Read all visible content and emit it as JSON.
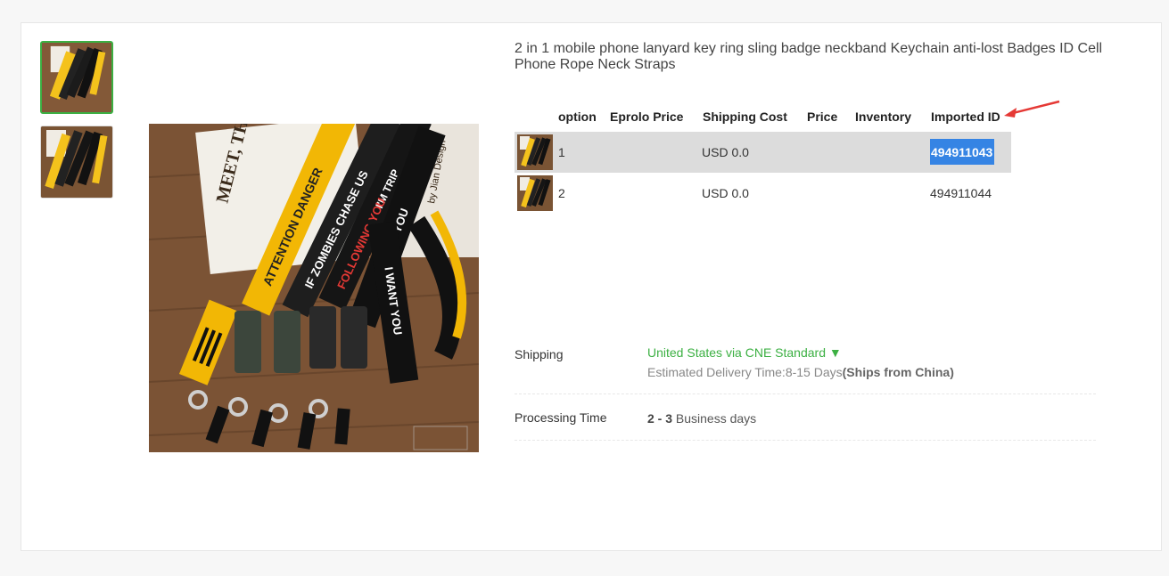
{
  "product": {
    "title": "2 in 1 mobile phone lanyard key ring sling badge neckband Keychain anti-lost Badges ID Cell Phone Rope Neck Straps"
  },
  "gallery": {
    "photo_text": [
      "MEET, THEN; MISS, OR LOVE.",
      "by Jian Design",
      "ATTENTION DANGER",
      "IF ZOMBIES CHASE US",
      "I'M TRIP",
      "FOLLOWING YOU",
      "I WANT YOU",
      "I WANT YOU"
    ]
  },
  "variants": {
    "headers": {
      "option": "option",
      "eprolo_price": "Eprolo Price",
      "shipping_cost": "Shipping Cost",
      "price": "Price",
      "inventory": "Inventory",
      "imported_id": "Imported ID"
    },
    "rows": [
      {
        "option": "1",
        "eprolo_price": "",
        "shipping_cost": "USD 0.0",
        "price": "",
        "inventory": "",
        "imported_id": "494911043"
      },
      {
        "option": "2",
        "eprolo_price": "",
        "shipping_cost": "USD 0.0",
        "price": "",
        "inventory": "",
        "imported_id": "494911044"
      }
    ]
  },
  "shipping": {
    "label": "Shipping",
    "method": "United States via CNE Standard ▼",
    "estimate_prefix": "Estimated Delivery Time:8-15 Days",
    "estimate_origin": "(Ships from China)"
  },
  "processing": {
    "label": "Processing Time",
    "value_bold": "2 - 3",
    "value_suffix": " Business days"
  },
  "colors": {
    "accent_green": "#3cb043",
    "selection_blue": "#3584e4",
    "arrow_red": "#e53935",
    "selected_row": "#dcdcdc"
  }
}
